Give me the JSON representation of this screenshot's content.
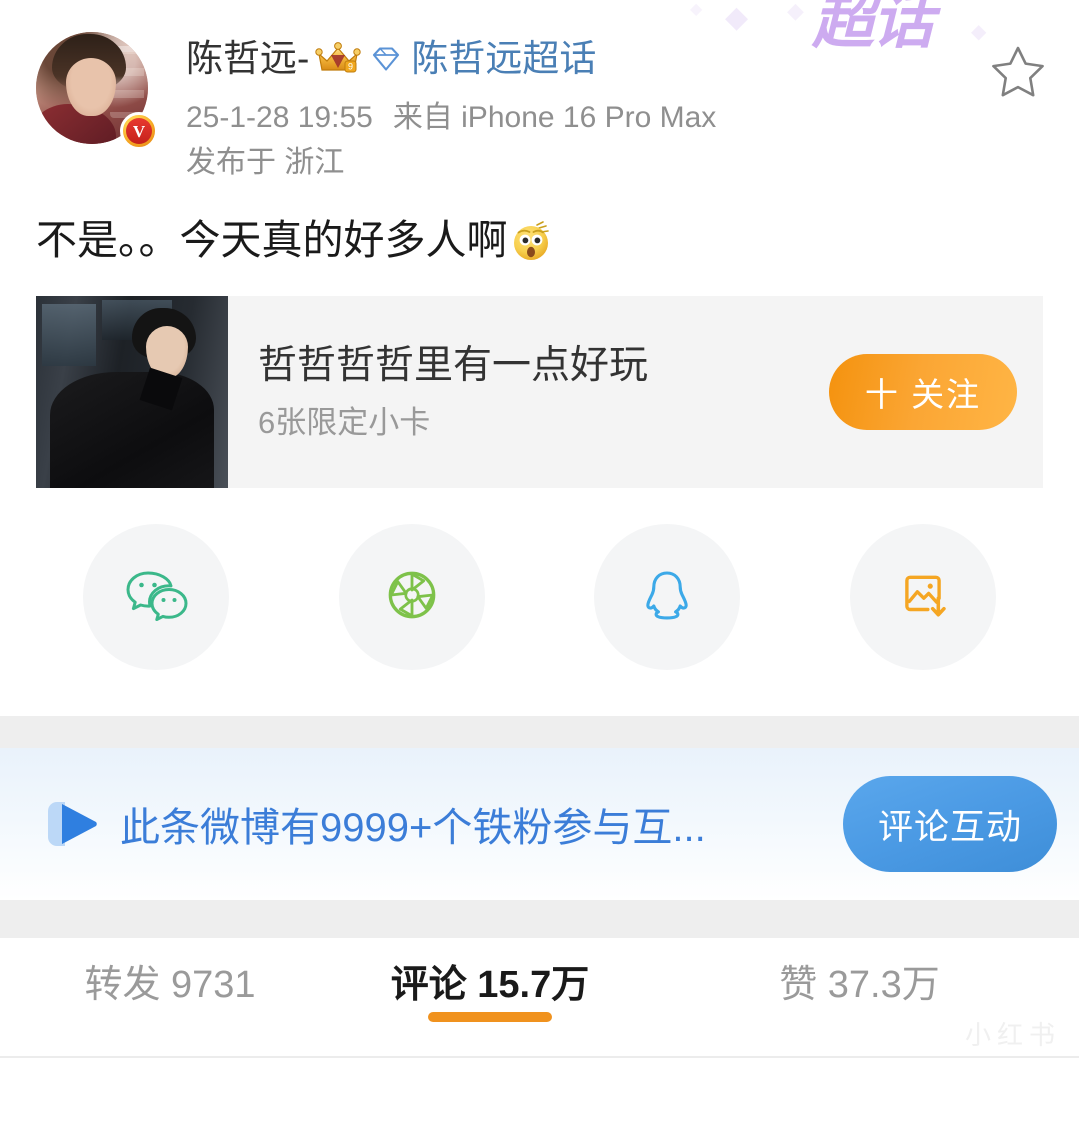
{
  "decor": {
    "top_watermark_text": "超话",
    "top_watermark_color": "#c9a4ef",
    "diamond_glyph": "◆",
    "bottom_watermark_text": "小红书"
  },
  "header": {
    "avatar_name": "user-avatar",
    "verified_letter": "V",
    "username": "陈哲远-",
    "crown_badge_name": "crown-level-badge",
    "crown_level": "9",
    "supertopic_icon_name": "supertopic-diamond-icon",
    "supertopic_link": "陈哲远超话",
    "supertopic_link_color": "#4a7fb5",
    "timestamp": "25-1-28 19:55",
    "source": "来自 iPhone 16 Pro Max",
    "region": "发布于 浙江",
    "star_icon_name": "favorite-star-icon"
  },
  "post": {
    "text": "不是。。今天真的好多人啊",
    "emoji_name": "shocked-face-emoji"
  },
  "card": {
    "image_name": "card-thumbnail",
    "title": "哲哲哲哲里有一点好玩",
    "subtitle": "6张限定小卡",
    "follow_label": "十 关注",
    "follow_color": "#f9a227"
  },
  "share": {
    "items": [
      {
        "name": "wechat",
        "icon": "wechat-icon",
        "color": "#3bb88a"
      },
      {
        "name": "moments",
        "icon": "wechat-moments-icon",
        "color": "#7ec24a"
      },
      {
        "name": "qq",
        "icon": "qq-icon",
        "color": "#3ca9e8"
      },
      {
        "name": "save-image",
        "icon": "save-image-icon",
        "color": "#f5a623"
      }
    ]
  },
  "fan_banner": {
    "icon_name": "fan-play-icon",
    "text": "此条微博有9999+个铁粉参与互...",
    "text_color": "#3b7dd8",
    "button_label": "评论互动",
    "button_color": "#4b9ae4"
  },
  "stats": {
    "items": [
      {
        "label": "转发 9731",
        "active": false
      },
      {
        "label": "评论 15.7万",
        "active": true
      },
      {
        "label": "赞 37.3万",
        "active": false
      }
    ],
    "active_underline_color": "#f0921e"
  }
}
